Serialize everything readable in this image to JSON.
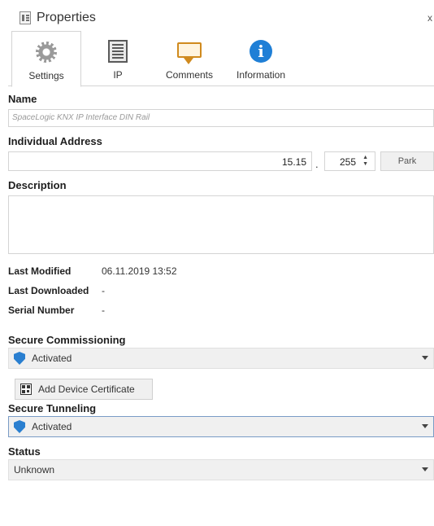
{
  "window": {
    "title": "Properties",
    "close_glyph": "x"
  },
  "tabs": [
    {
      "label": "Settings",
      "icon": "gear-icon",
      "active": true
    },
    {
      "label": "IP",
      "icon": "ip-document-icon",
      "active": false
    },
    {
      "label": "Comments",
      "icon": "comment-bubble-icon",
      "active": false
    },
    {
      "label": "Information",
      "icon": "info-icon",
      "active": false
    }
  ],
  "name": {
    "label": "Name",
    "value": "SpaceLogic KNX IP Interface DIN Rail"
  },
  "individual_address": {
    "label": "Individual Address",
    "value": "15.15",
    "separator": ".",
    "device": "255",
    "spin_arrows": "▲\n▼",
    "park_label": "Park"
  },
  "description": {
    "label": "Description",
    "value": ""
  },
  "meta": {
    "last_modified_label": "Last Modified",
    "last_modified_value": "06.11.2019 13:52",
    "last_downloaded_label": "Last Downloaded",
    "last_downloaded_value": "-",
    "serial_number_label": "Serial Number",
    "serial_number_value": "-"
  },
  "secure_commissioning": {
    "label": "Secure Commissioning",
    "value": "Activated",
    "icon": "shield-icon"
  },
  "add_certificate": {
    "label": "Add Device Certificate",
    "icon": "qr-code-icon"
  },
  "secure_tunneling": {
    "label": "Secure Tunneling",
    "value": "Activated",
    "icon": "shield-icon"
  },
  "status": {
    "label": "Status",
    "value": "Unknown"
  },
  "colors": {
    "accent": "#1f7fd6",
    "shield": "#2a7fd0",
    "comment_icon": "#d08a1e",
    "focus_border": "#7a9cc6"
  }
}
